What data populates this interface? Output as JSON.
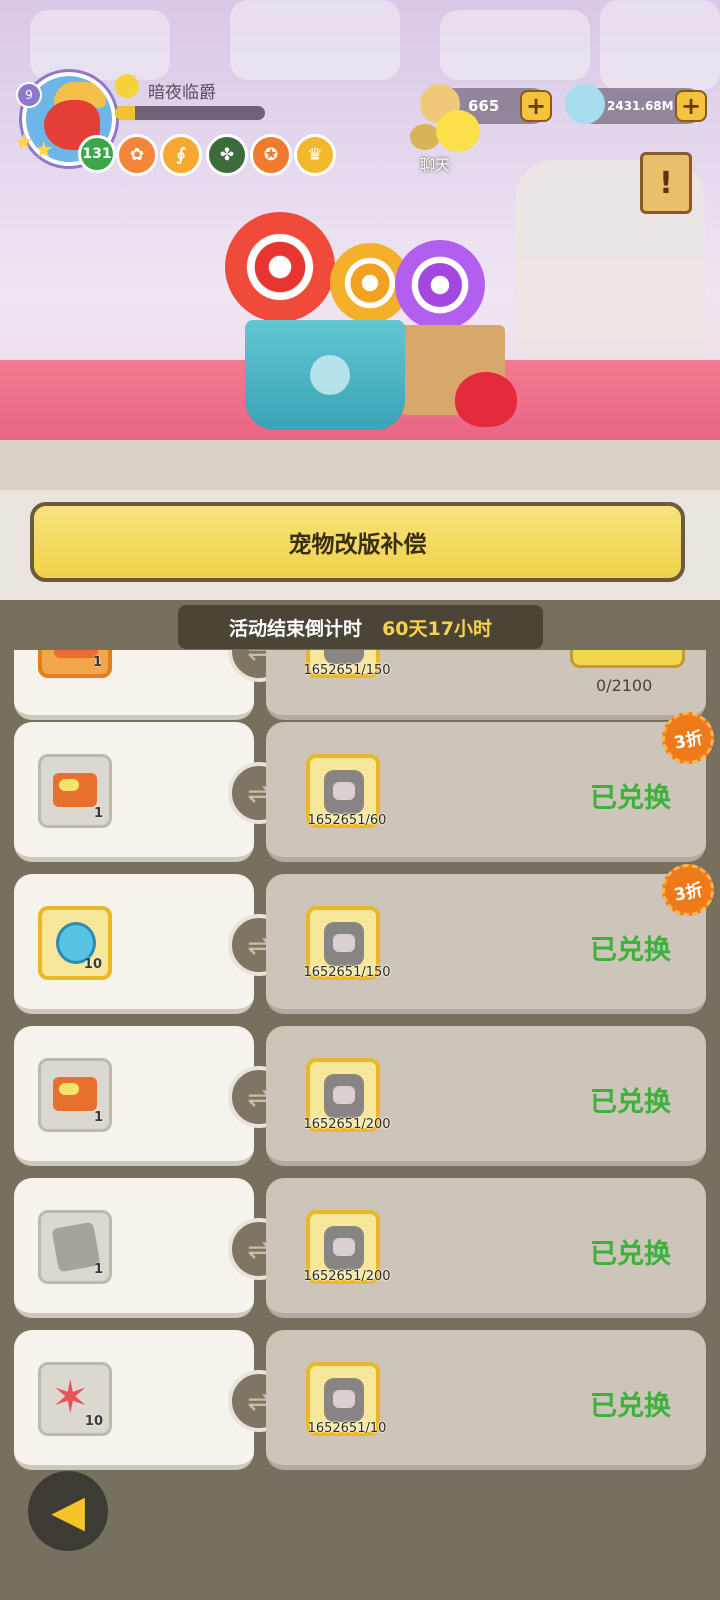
{
  "player": {
    "name": "暗夜临爵",
    "level": "131",
    "vip": "9",
    "xp_progress": 0.13
  },
  "resources": {
    "gems": "665",
    "coins": "2431.68M"
  },
  "chat": {
    "label": "聊天"
  },
  "event": {
    "title": "宠物改版补偿",
    "countdown_label": "活动结束倒计时",
    "countdown_value": "60天17小时"
  },
  "rows": [
    {
      "reward_qty": "1",
      "cost": "1652651/150",
      "progress": "0/2100",
      "status": ""
    },
    {
      "reward_qty": "1",
      "cost": "1652651/60",
      "status": "已兑换",
      "discount": "3折"
    },
    {
      "reward_qty": "10",
      "cost": "1652651/150",
      "status": "已兑换",
      "discount": "3折"
    },
    {
      "reward_qty": "1",
      "cost": "1652651/200",
      "status": "已兑换"
    },
    {
      "reward_qty": "1",
      "cost": "1652651/200",
      "status": "已兑换"
    },
    {
      "reward_qty": "10",
      "cost": "1652651/10",
      "status": "已兑换"
    }
  ],
  "icons": {
    "back": "back-arrow-icon",
    "swap": "exchange-icon",
    "notice": "exclamation-scroll-icon"
  }
}
